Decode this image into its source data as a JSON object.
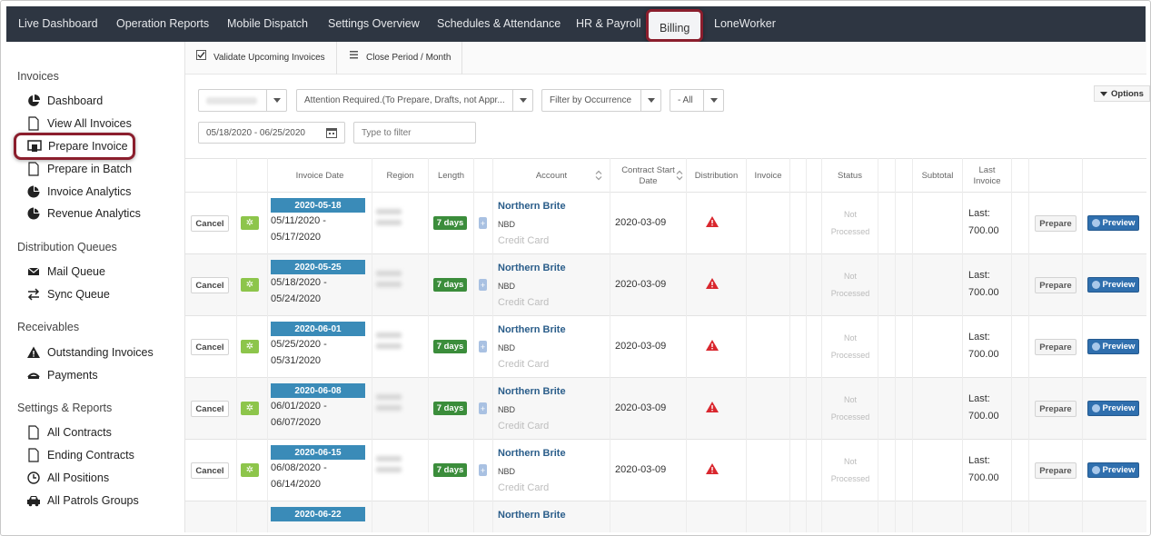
{
  "nav": {
    "items": [
      "Live Dashboard",
      "Operation Reports",
      "Mobile Dispatch",
      "Settings Overview",
      "Schedules & Attendance",
      "HR & Payroll",
      "Billing",
      "LoneWorker"
    ],
    "active": "Billing"
  },
  "sidebar": {
    "sections": [
      {
        "title": "Invoices",
        "items": [
          "Dashboard",
          "View All Invoices",
          "Prepare Invoice",
          "Prepare in Batch",
          "Invoice Analytics",
          "Revenue Analytics"
        ]
      },
      {
        "title": "Distribution Queues",
        "items": [
          "Mail Queue",
          "Sync Queue"
        ]
      },
      {
        "title": "Receivables",
        "items": [
          "Outstanding Invoices",
          "Payments"
        ]
      },
      {
        "title": "Settings & Reports",
        "items": [
          "All Contracts",
          "Ending Contracts",
          "All Positions",
          "All Patrols Groups"
        ]
      }
    ],
    "active": "Prepare Invoice"
  },
  "toolbar": {
    "validate_label": "Validate Upcoming Invoices",
    "close_period_label": "Close Period / Month"
  },
  "filters": {
    "status_filter": "Attention Required.(To Prepare, Drafts, not Appr...",
    "occurrence_filter": "Filter by Occurrence",
    "all_filter": "- All",
    "date_range": "05/18/2020 - 06/25/2020",
    "text_filter_placeholder": "Type to filter",
    "options_label": "Options"
  },
  "table": {
    "headers": {
      "invoice_date": "Invoice Date",
      "region": "Region",
      "length": "Length",
      "account": "Account",
      "contract_start_1": "Contract Start",
      "contract_start_2": "Date",
      "distribution": "Distribution",
      "invoice": "Invoice",
      "status": "Status",
      "subtotal": "Subtotal",
      "last_invoice_1": "Last",
      "last_invoice_2": "Invoice"
    },
    "rows": [
      {
        "cancel": "Cancel",
        "date": "2020-05-18",
        "range_start": "05/11/2020 -",
        "range_end": "05/17/2020",
        "length": "7 days",
        "plus": "+",
        "account": "Northern Brite",
        "code": "NBD",
        "payment": "Credit Card",
        "contract_start": "2020-03-09",
        "status_1": "Not",
        "status_2": "Processed",
        "last_1": "Last:",
        "last_2": "700.00",
        "prepare": "Prepare",
        "preview": "Preview"
      },
      {
        "cancel": "Cancel",
        "date": "2020-05-25",
        "range_start": "05/18/2020 -",
        "range_end": "05/24/2020",
        "length": "7 days",
        "plus": "+",
        "account": "Northern Brite",
        "code": "NBD",
        "payment": "Credit Card",
        "contract_start": "2020-03-09",
        "status_1": "Not",
        "status_2": "Processed",
        "last_1": "Last:",
        "last_2": "700.00",
        "prepare": "Prepare",
        "preview": "Preview"
      },
      {
        "cancel": "Cancel",
        "date": "2020-06-01",
        "range_start": "05/25/2020 -",
        "range_end": "05/31/2020",
        "length": "7 days",
        "plus": "+",
        "account": "Northern Brite",
        "code": "NBD",
        "payment": "Credit Card",
        "contract_start": "2020-03-09",
        "status_1": "Not",
        "status_2": "Processed",
        "last_1": "Last:",
        "last_2": "700.00",
        "prepare": "Prepare",
        "preview": "Preview"
      },
      {
        "cancel": "Cancel",
        "date": "2020-06-08",
        "range_start": "06/01/2020 -",
        "range_end": "06/07/2020",
        "length": "7 days",
        "plus": "+",
        "account": "Northern Brite",
        "code": "NBD",
        "payment": "Credit Card",
        "contract_start": "2020-03-09",
        "status_1": "Not",
        "status_2": "Processed",
        "last_1": "Last:",
        "last_2": "700.00",
        "prepare": "Prepare",
        "preview": "Preview"
      },
      {
        "cancel": "Cancel",
        "date": "2020-06-15",
        "range_start": "06/08/2020 -",
        "range_end": "06/14/2020",
        "length": "7 days",
        "plus": "+",
        "account": "Northern Brite",
        "code": "NBD",
        "payment": "Credit Card",
        "contract_start": "2020-03-09",
        "status_1": "Not",
        "status_2": "Processed",
        "last_1": "Last:",
        "last_2": "700.00",
        "prepare": "Prepare",
        "preview": "Preview"
      },
      {
        "date": "2020-06-22",
        "account": "Northern Brite"
      }
    ]
  },
  "colors": {
    "nav_bg": "#2e3642",
    "highlight_border": "#8b1e2d",
    "date_badge": "#3a8bb8",
    "days_badge": "#3b8d3b",
    "gear_btn": "#8dc54b",
    "account_link": "#2a5d8a",
    "warning": "#d9272e",
    "preview_btn": "#2f6fae"
  },
  "icons": {
    "distribution": "warning-triangle-icon",
    "settings": "gear-icon"
  }
}
